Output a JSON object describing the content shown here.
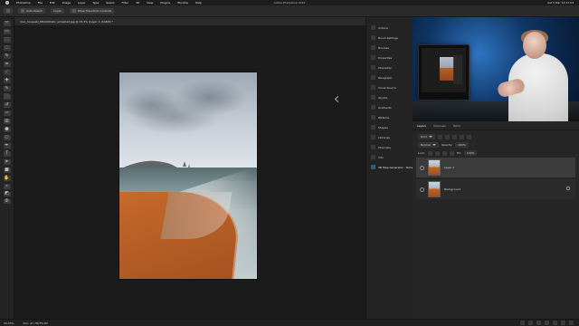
{
  "macos_menubar": {
    "app": "Photoshop",
    "items": [
      "File",
      "Edit",
      "Image",
      "Layer",
      "Type",
      "Select",
      "Filter",
      "3D",
      "View",
      "Plugins",
      "Window",
      "Help"
    ],
    "center_title": "Adobe Photoshop 2022",
    "clock": "Sat 5 Mar 14:47:03"
  },
  "options_bar": {
    "auto_select_label": "Auto-Select:",
    "auto_select_value": "Layer",
    "show_transform_controls": "Show Transform Controls"
  },
  "document_tab": {
    "title": "mac_housestl_6f0dd47ebc_smashed.jpg @ 33.3% (Layer 1, RGB/8) *"
  },
  "mid_dock": {
    "items": [
      {
        "label": "Actions",
        "icon": "actions-icon"
      },
      {
        "label": "Brush Settings",
        "icon": "brush-settings-icon"
      },
      {
        "label": "Brushes",
        "icon": "brushes-icon"
      },
      {
        "label": "Properties",
        "icon": "properties-icon"
      },
      {
        "label": "Character",
        "icon": "character-icon"
      },
      {
        "label": "Paragraph",
        "icon": "paragraph-icon"
      },
      {
        "label": "Clone Source",
        "icon": "clone-source-icon"
      },
      {
        "label": "Glyphs",
        "icon": "glyphs-icon"
      },
      {
        "label": "Gradients",
        "icon": "gradients-icon"
      },
      {
        "label": "Patterns",
        "icon": "patterns-icon"
      },
      {
        "label": "Shapes",
        "icon": "shapes-icon"
      },
      {
        "label": "Libraries",
        "icon": "libraries-icon"
      },
      {
        "label": "Channels",
        "icon": "channels-icon"
      },
      {
        "label": "Info",
        "icon": "info-icon"
      },
      {
        "label": "3D Map Generator - Terrain",
        "icon": "3d-map-icon"
      }
    ]
  },
  "layers_panel": {
    "tabs": [
      "Layers",
      "Channels",
      "Paths"
    ],
    "active_tab": "Layers",
    "kind_label": "Kind",
    "blend_mode": "Normal",
    "opacity_label": "Opacity:",
    "opacity_value": "100%",
    "lock_label": "Lock:",
    "fill_label": "Fill:",
    "fill_value": "100%",
    "layers": [
      {
        "name": "Layer 1",
        "selected": true
      },
      {
        "name": "Background",
        "selected": false
      }
    ]
  },
  "status_bar": {
    "zoom": "33.33%",
    "doc": "Doc: 47.7M/75.0M"
  }
}
